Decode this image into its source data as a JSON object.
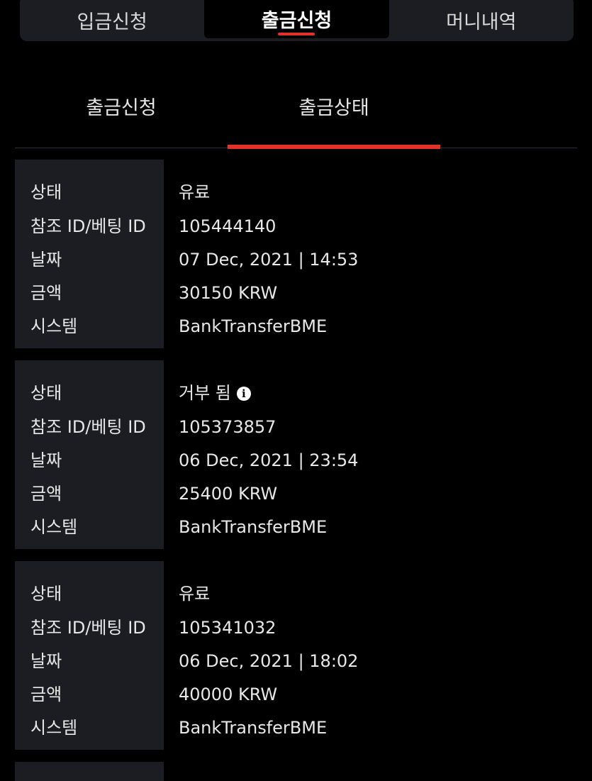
{
  "top_tabs": [
    {
      "label": "입금신청",
      "active": false
    },
    {
      "label": "출금신청",
      "active": true
    },
    {
      "label": "머니내역",
      "active": false
    }
  ],
  "sub_tabs": [
    {
      "label": "출금신청",
      "active": false
    },
    {
      "label": "출금상태",
      "active": true
    }
  ],
  "field_labels": {
    "status": "상태",
    "ref_id": "참조 ID/베팅 ID",
    "date": "날짜",
    "amount": "금액",
    "system": "시스템"
  },
  "records": [
    {
      "status": "유료",
      "ref_id": "105444140",
      "date": "07 Dec, 2021 | 14:53",
      "amount": "30150 KRW",
      "system": "BankTransferBME",
      "has_info_icon": false
    },
    {
      "status": "거부 됨",
      "ref_id": "105373857",
      "date": "06 Dec, 2021 | 23:54",
      "amount": "25400 KRW",
      "system": "BankTransferBME",
      "has_info_icon": true,
      "info_icon": "info-circle-icon"
    },
    {
      "status": "유료",
      "ref_id": "105341032",
      "date": "06 Dec, 2021 | 18:02",
      "amount": "40000 KRW",
      "system": "BankTransferBME",
      "has_info_icon": false
    }
  ],
  "colors": {
    "background": "#000000",
    "panel": "#1b1d22",
    "accent": "#e3322b",
    "text": "#e8e8e8"
  }
}
